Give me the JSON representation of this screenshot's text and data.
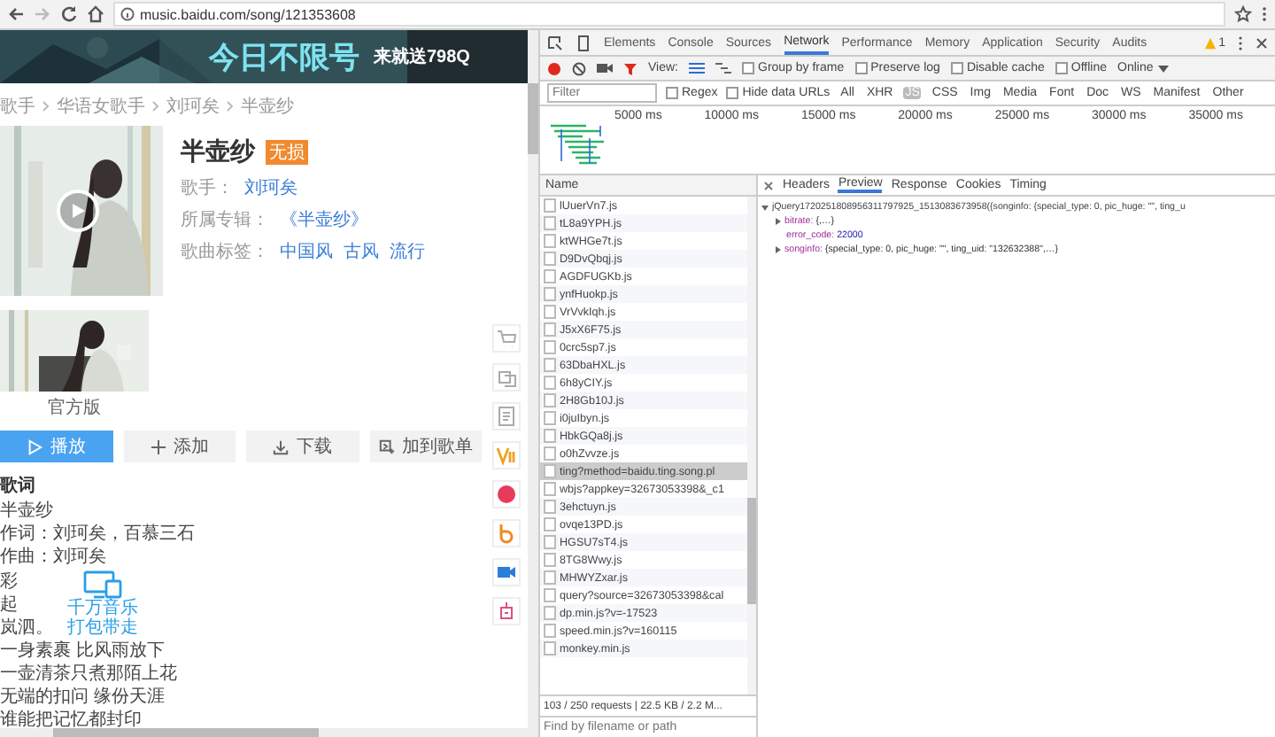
{
  "browser": {
    "url": "music.baidu.com/song/121353608"
  },
  "page": {
    "banner": {
      "headline": "今日不限号",
      "offer": "来就送798Q"
    },
    "breadcrumb": [
      "歌手",
      "华语女歌手",
      "刘珂矣",
      "半壶纱"
    ],
    "song": {
      "title": "半壶纱",
      "badge": "无损",
      "fields": [
        {
          "label": "歌手：",
          "links": [
            "刘珂矣"
          ]
        },
        {
          "label": "所属专辑：",
          "links": [
            "《半壶纱》"
          ]
        },
        {
          "label": "歌曲标签：",
          "links": [
            "中国风",
            "古风",
            "流行"
          ]
        }
      ]
    },
    "mv_caption": "官方版",
    "actions": [
      {
        "label": "播放",
        "kind": "play",
        "primary": true
      },
      {
        "label": "添加",
        "kind": "plus",
        "primary": false
      },
      {
        "label": "下载",
        "kind": "download",
        "primary": false
      },
      {
        "label": "加到歌单",
        "kind": "list",
        "primary": false
      }
    ],
    "lyrics": {
      "heading": "歌词",
      "lines": [
        "半壶纱",
        "作词：刘珂矣，百慕三石",
        "作曲：刘珂矣"
      ],
      "side_lines": [
        "彩",
        "起",
        "岚泗。"
      ],
      "lower_lines": [
        "一身素裹 比风雨放下",
        "一壶清茶只煮那陌上花",
        "无端的扣问 缘份天涯",
        "谁能把记忆都封印"
      ]
    },
    "widget": {
      "lines": [
        "千万音乐",
        "打包带走"
      ]
    },
    "side_icons": [
      {
        "kind": "cart"
      },
      {
        "kind": "share"
      },
      {
        "kind": "note"
      },
      {
        "kind": "vip"
      },
      {
        "kind": "heart"
      },
      {
        "kind": "b"
      },
      {
        "kind": "camera"
      },
      {
        "kind": "robot"
      }
    ]
  },
  "devtools": {
    "tabs": [
      {
        "label": "Elements",
        "selected": false
      },
      {
        "label": "Console",
        "selected": false
      },
      {
        "label": "Sources",
        "selected": false
      },
      {
        "label": "Network",
        "selected": true
      },
      {
        "label": "Performance",
        "selected": false
      },
      {
        "label": "Memory",
        "selected": false
      },
      {
        "label": "Application",
        "selected": false
      },
      {
        "label": "Security",
        "selected": false
      },
      {
        "label": "Audits",
        "selected": false
      }
    ],
    "warning_count": "1",
    "recording": true,
    "view_label": "View:",
    "toolbar_options": [
      {
        "label": "Group by frame",
        "checked": false
      },
      {
        "label": "Preserve log",
        "checked": false
      },
      {
        "label": "Disable cache",
        "checked": false
      },
      {
        "label": "Offline",
        "checked": false
      }
    ],
    "throttle": "Online",
    "filter": {
      "placeholder": "Filter",
      "options": [
        {
          "label": "Regex",
          "checked": false
        },
        {
          "label": "Hide data URLs",
          "checked": false
        }
      ],
      "types": [
        {
          "label": "All",
          "selected": false
        },
        {
          "label": "XHR",
          "selected": false
        },
        {
          "label": "JS",
          "selected": true
        },
        {
          "label": "CSS",
          "selected": false
        },
        {
          "label": "Img",
          "selected": false
        },
        {
          "label": "Media",
          "selected": false
        },
        {
          "label": "Font",
          "selected": false
        },
        {
          "label": "Doc",
          "selected": false
        },
        {
          "label": "WS",
          "selected": false
        },
        {
          "label": "Manifest",
          "selected": false
        },
        {
          "label": "Other",
          "selected": false
        }
      ]
    },
    "timeline_ticks": [
      "5000 ms",
      "10000 ms",
      "15000 ms",
      "20000 ms",
      "25000 ms",
      "30000 ms",
      "35000 ms"
    ],
    "name_header": "Name",
    "requests": [
      {
        "name": "lUuerVn7.js",
        "selected": false
      },
      {
        "name": "tL8a9YPH.js",
        "selected": false
      },
      {
        "name": "ktWHGe7t.js",
        "selected": false
      },
      {
        "name": "D9DvQbqj.js",
        "selected": false
      },
      {
        "name": "AGDFUGKb.js",
        "selected": false
      },
      {
        "name": "ynfHuokp.js",
        "selected": false
      },
      {
        "name": "VrVvkIqh.js",
        "selected": false
      },
      {
        "name": "J5xX6F75.js",
        "selected": false
      },
      {
        "name": "0crc5sp7.js",
        "selected": false
      },
      {
        "name": "63DbaHXL.js",
        "selected": false
      },
      {
        "name": "6h8yCIY.js",
        "selected": false
      },
      {
        "name": "2H8Gb10J.js",
        "selected": false
      },
      {
        "name": "i0juIbyn.js",
        "selected": false
      },
      {
        "name": "HbkGQa8j.js",
        "selected": false
      },
      {
        "name": "o0hZvvze.js",
        "selected": false
      },
      {
        "name": "ting?method=baidu.ting.song.pl",
        "selected": true
      },
      {
        "name": "wbjs?appkey=32673053398&_c1",
        "selected": false
      },
      {
        "name": "3ehctuyn.js",
        "selected": false
      },
      {
        "name": "ovqe13PD.js",
        "selected": false
      },
      {
        "name": "HGSU7sT4.js",
        "selected": false
      },
      {
        "name": "8TG8Wwy.js",
        "selected": false
      },
      {
        "name": "MHWYZxar.js",
        "selected": false
      },
      {
        "name": "query?source=32673053398&cal",
        "selected": false
      },
      {
        "name": "dp.min.js?v=-17523",
        "selected": false
      },
      {
        "name": "speed.min.js?v=160115",
        "selected": false
      },
      {
        "name": "monkey.min.js",
        "selected": false
      }
    ],
    "status": "103 / 250 requests | 22.5 KB / 2.2 M...",
    "find_placeholder": "Find by filename or path",
    "detail_tabs": [
      {
        "label": "Headers",
        "selected": false
      },
      {
        "label": "Preview",
        "selected": true
      },
      {
        "label": "Response",
        "selected": false
      },
      {
        "label": "Cookies",
        "selected": false
      },
      {
        "label": "Timing",
        "selected": false
      }
    ],
    "tree": {
      "text": "jQuery1720251808956311797925_1513083673958({songinfo: {special_type: 0, pic_huge: \"\", ting_u",
      "expanded": true,
      "children": [
        {
          "key": "bitrate:",
          "value": "{,…}",
          "expandable": true
        },
        {
          "key": "error_code:",
          "value": "22000",
          "expandable": false
        },
        {
          "key": "songinfo:",
          "value": "{special_type: 0, pic_huge: \"\", ting_uid: \"132632388\",…}",
          "expandable": true
        }
      ]
    }
  }
}
